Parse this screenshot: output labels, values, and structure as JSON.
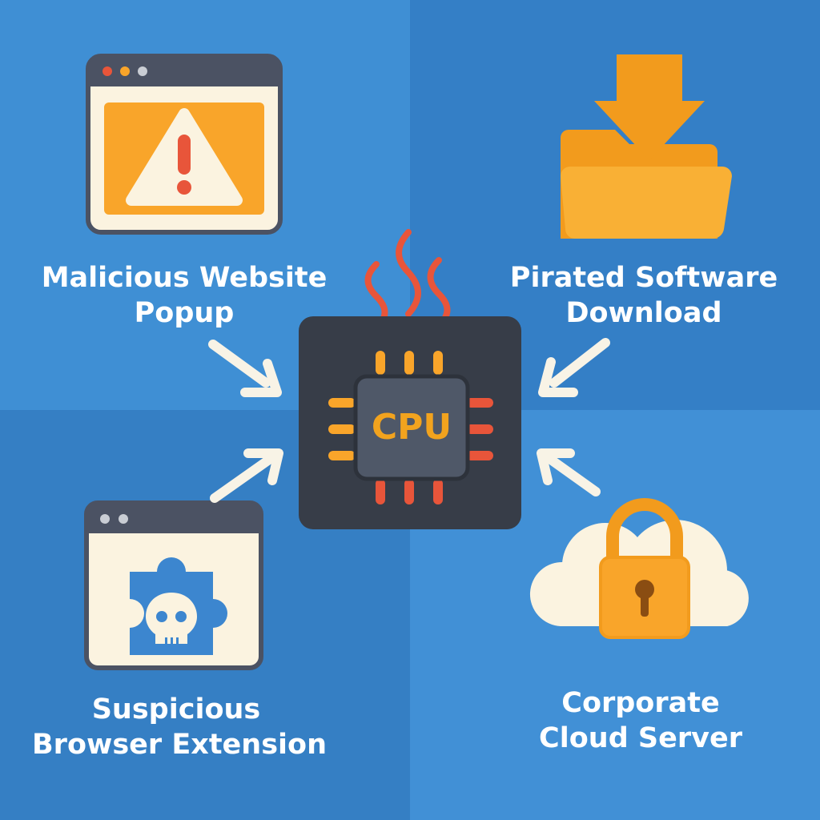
{
  "nodes": {
    "malicious_website": {
      "line1": "Malicious Website",
      "line2": "Popup"
    },
    "pirated_software": {
      "line1": "Pirated Software",
      "line2": "Download"
    },
    "browser_extension": {
      "line1": "Suspicious",
      "line2": "Browser Extension"
    },
    "cloud_server": {
      "line1": "Corporate",
      "line2": "Cloud Server"
    }
  },
  "center": {
    "label": "CPU"
  },
  "icons": {
    "top_left": "warning-window-icon",
    "top_right": "download-folder-icon",
    "bottom_left": "skull-puzzle-window-icon",
    "bottom_right": "cloud-lock-icon",
    "center": "cpu-chip-icon"
  },
  "colors": {
    "background_light": "#3f8fd4",
    "background_dark": "#347fc6",
    "accent_orange": "#f9a52a",
    "heat_red": "#e8553a",
    "chip_dark": "#373d48",
    "window_cream": "#fbf3e0",
    "arrow": "#f8f3e6"
  }
}
